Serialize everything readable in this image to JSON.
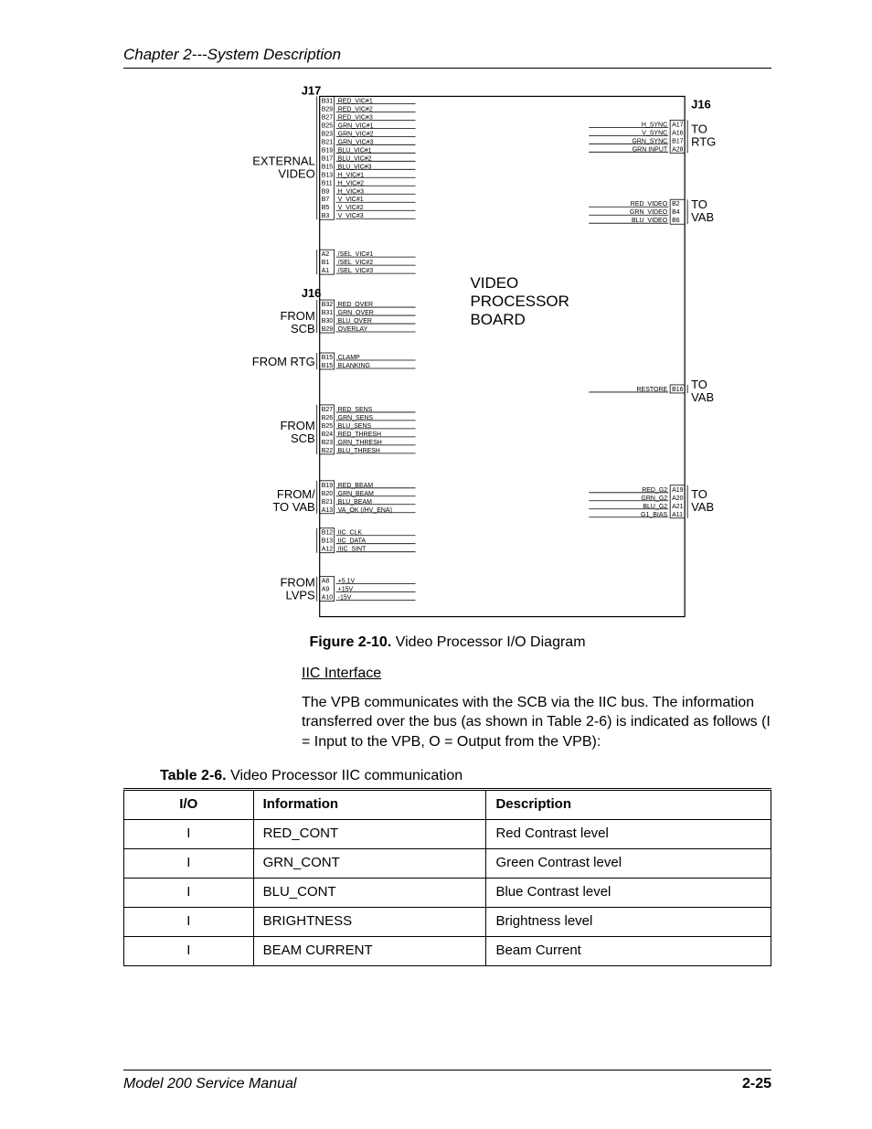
{
  "header": {
    "chapter": "Chapter 2---System Description"
  },
  "figure": {
    "caption_prefix": "Figure 2-10.",
    "caption_text": "  Video Processor I/O Diagram",
    "board_label_l1": "VIDEO",
    "board_label_l2": "PROCESSOR",
    "board_label_l3": "BOARD"
  },
  "left": {
    "j17": "J17",
    "external": "EXTERNAL",
    "video": "VIDEO",
    "j16": "J16",
    "from1": "FROM",
    "scb1": "SCB",
    "from_rtg": "FROM RTG",
    "from2": "FROM",
    "scb2": "SCB",
    "fromto": "FROM/",
    "tovab": "TO VAB",
    "from3": "FROM",
    "lvps": "LVPS"
  },
  "left_signals": {
    "j17_pins": [
      "B31",
      "B29",
      "B27",
      "B25",
      "B23",
      "B21",
      "B19",
      "B17",
      "B15",
      "B13",
      "B11",
      "B9",
      "B7",
      "B5",
      "B3"
    ],
    "j17_sigs": [
      "RED_VIC#1",
      "RED_VIC#2",
      "RED_VIC#3",
      "GRN_VIC#1",
      "GRN_VIC#2",
      "GRN_VIC#3",
      "BLU_VIC#1",
      "BLU_VIC#2",
      "BLU_VIC#3",
      "H_VIC#1",
      "H_VIC#2",
      "H_VIC#3",
      "V_VIC#1",
      "V_VIC#2",
      "V_VIC#3"
    ],
    "sel_pins": [
      "A2",
      "B1",
      "A1"
    ],
    "sel_sigs": [
      "/SEL_VIC#1",
      "/SEL_VIC#2",
      "/SEL_VIC#3"
    ],
    "over_pins": [
      "B32",
      "B31",
      "B30",
      "B29"
    ],
    "over_sigs": [
      "RED_OVER",
      "GRN_OVER",
      "BLU_OVER",
      "OVERLAY"
    ],
    "clamp_pins": [
      "B15",
      "B15"
    ],
    "clamp_sigs": [
      "CLAMP",
      "BLANKING"
    ],
    "sens_pins": [
      "B27",
      "B26",
      "B25",
      "B24",
      "B23",
      "B22"
    ],
    "sens_sigs": [
      "RED_SENS",
      "GRN_SENS",
      "BLU_SENS",
      "RED_THRESH",
      "GRN_THRESH",
      "BLU_THRESH"
    ],
    "beam_pins": [
      "B19",
      "B20",
      "B21",
      "A13"
    ],
    "beam_sigs": [
      "RED_BEAM",
      "GRN_BEAM",
      "BLU_BEAM",
      "VA_OK (/HV_ENA)"
    ],
    "iic_pins": [
      "B12",
      "B13",
      "A12"
    ],
    "iic_sigs": [
      "IIC_CLK",
      "IIC_DATA",
      "/IIC_SINT"
    ],
    "lvps_pins": [
      "A8",
      "A9",
      "A10"
    ],
    "lvps_sigs": [
      "+5.1V",
      "+15V",
      "-15V"
    ]
  },
  "right": {
    "j16": "J16",
    "to1": "TO",
    "rtg": "RTG",
    "to2": "TO",
    "vab2": "VAB",
    "to3": "TO",
    "vab3": "VAB",
    "to4": "TO",
    "vab4": "VAB",
    "sync_sigs": [
      "H_SYNC",
      "V_SYNC",
      "GRN_SYNC",
      "GRN INPUT"
    ],
    "sync_pins": [
      "A17",
      "A16",
      "B17",
      "A28"
    ],
    "video_sigs": [
      "RED_VIDEO",
      "GRN_VIDEO",
      "BLU_VIDEO"
    ],
    "video_pins": [
      "B2",
      "B4",
      "B6"
    ],
    "restore_sig": "RESTORE",
    "restore_pin": "B16",
    "g2_sigs": [
      "RED_G2",
      "GRN_G2",
      "BLU_G2",
      "G1_BIAS"
    ],
    "g2_pins": [
      "A19",
      "A20",
      "A21",
      "A11"
    ]
  },
  "section": {
    "heading": "IIC Interface",
    "body": "The VPB communicates with the SCB via the IIC bus. The information transferred over the bus (as shown in Table 2-6) is indicated as follows (I = Input to the VPB, O = Output from the VPB):"
  },
  "table": {
    "caption_prefix": "Table 2-6.",
    "caption_text": "  Video Processor IIC communication",
    "headers": [
      "I/O",
      "Information",
      "Description"
    ],
    "rows": [
      [
        "I",
        "RED_CONT",
        "Red Contrast level"
      ],
      [
        "I",
        "GRN_CONT",
        "Green Contrast level"
      ],
      [
        "I",
        "BLU_CONT",
        "Blue Contrast level"
      ],
      [
        "I",
        "BRIGHTNESS",
        "Brightness level"
      ],
      [
        "I",
        "BEAM CURRENT",
        "Beam Current"
      ]
    ]
  },
  "footer": {
    "left": "Model 200 Service Manual",
    "right": "2-25"
  }
}
